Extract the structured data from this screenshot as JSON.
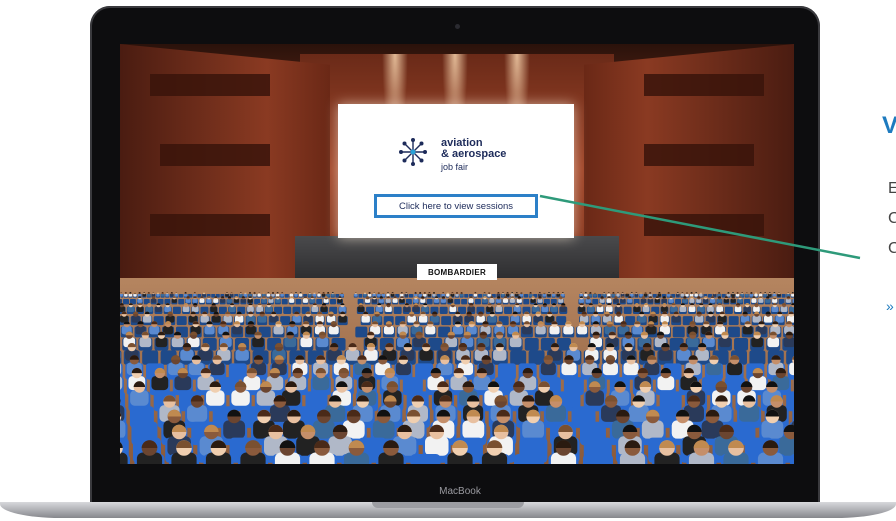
{
  "device": {
    "brand_label": "MacBook"
  },
  "auditorium": {
    "board": {
      "logo_line1": "aviation",
      "logo_line2": "& aerospace",
      "logo_sub": "job fair",
      "sessions_link": "Click here to view sessions"
    },
    "sponsor": "BOMBARDIER"
  },
  "side_text": {
    "heading": "V",
    "line1": "E",
    "line2": "C",
    "line3": "C",
    "link": "»"
  },
  "colors": {
    "accent_blue": "#1e7bbf",
    "callout_green": "#2e9a7a",
    "highlight_border": "#2c80c8"
  }
}
